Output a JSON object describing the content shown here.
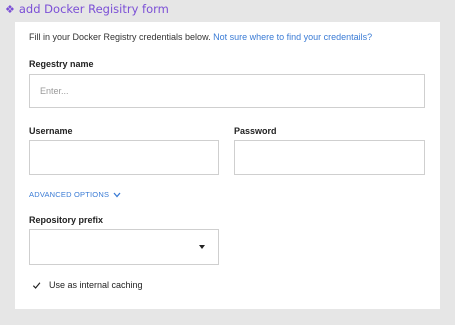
{
  "header": {
    "icon": "diamond-icon",
    "title": "add Docker Regisitry form",
    "accent_color": "#7b4fd6"
  },
  "form": {
    "intro_text": "Fill in your Docker Registry credentials below.",
    "intro_link": "Not sure where to find your credentails?",
    "registry_name": {
      "label": "Regestry name",
      "placeholder": "Enter...",
      "value": ""
    },
    "username": {
      "label": "Username",
      "value": ""
    },
    "password": {
      "label": "Password",
      "value": ""
    },
    "advanced_options_label": "ADVANCED OPTIONS",
    "repository_prefix": {
      "label": "Repository prefix",
      "selected": ""
    },
    "internal_caching": {
      "label": "Use as internal caching",
      "checked": true
    },
    "link_color": "#3a7bd5"
  }
}
